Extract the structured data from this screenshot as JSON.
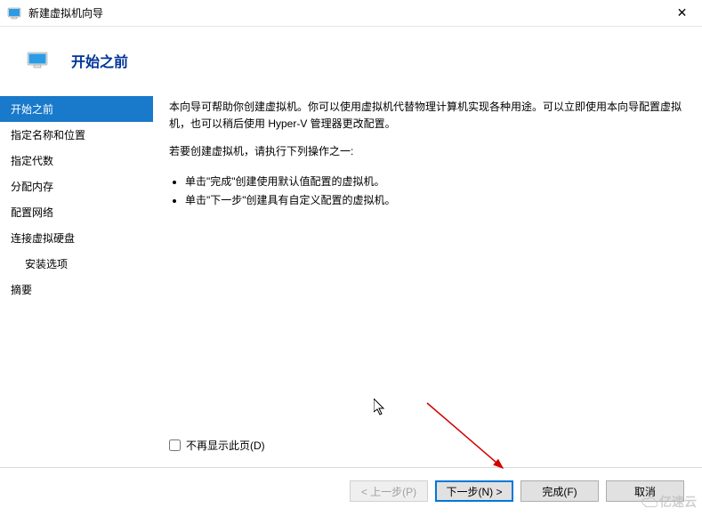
{
  "window": {
    "title": "新建虚拟机向导"
  },
  "header": {
    "title": "开始之前"
  },
  "sidebar": {
    "items": [
      {
        "label": "开始之前",
        "selected": true
      },
      {
        "label": "指定名称和位置"
      },
      {
        "label": "指定代数"
      },
      {
        "label": "分配内存"
      },
      {
        "label": "配置网络"
      },
      {
        "label": "连接虚拟硬盘"
      },
      {
        "label": "安装选项",
        "indent": true
      },
      {
        "label": "摘要"
      }
    ]
  },
  "content": {
    "para1": "本向导可帮助你创建虚拟机。你可以使用虚拟机代替物理计算机实现各种用途。可以立即使用本向导配置虚拟机，也可以稍后使用 Hyper-V 管理器更改配置。",
    "para2": "若要创建虚拟机，请执行下列操作之一:",
    "bullets": [
      "单击\"完成\"创建使用默认值配置的虚拟机。",
      "单击\"下一步\"创建具有自定义配置的虚拟机。"
    ],
    "checkbox_label": "不再显示此页(D)"
  },
  "footer": {
    "prev": "< 上一步(P)",
    "next": "下一步(N) >",
    "finish": "完成(F)",
    "cancel": "取消"
  },
  "watermark": "亿速云"
}
